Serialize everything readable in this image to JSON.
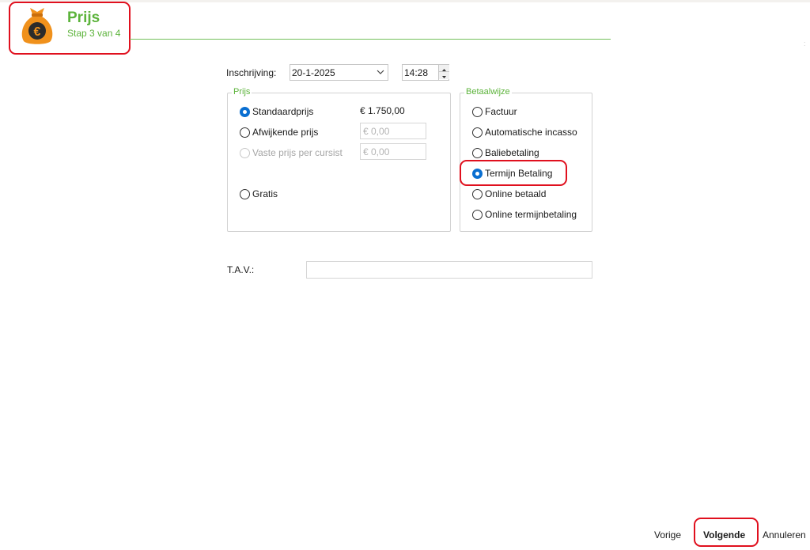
{
  "header": {
    "title": "Prijs",
    "step": "Stap 3 van 4",
    "icon": "money-bag-euro-icon"
  },
  "inschrijving": {
    "label": "Inschrijving:",
    "date": "20-1-2025",
    "time": "14:28"
  },
  "prijs": {
    "legend": "Prijs",
    "options": [
      {
        "label": "Standaardprijs",
        "selected": true,
        "value": "€ 1.750,00"
      },
      {
        "label": "Afwijkende prijs",
        "selected": false,
        "placeholder": "€ 0,00"
      },
      {
        "label": "Vaste prijs per cursist",
        "selected": false,
        "disabled": true,
        "placeholder": "€ 0,00"
      },
      {
        "label": "Gratis",
        "selected": false
      }
    ]
  },
  "betaalwijze": {
    "legend": "Betaalwijze",
    "options": [
      {
        "label": "Factuur",
        "selected": false
      },
      {
        "label": "Automatische incasso",
        "selected": false
      },
      {
        "label": "Baliebetaling",
        "selected": false
      },
      {
        "label": "Termijn Betaling",
        "selected": true
      },
      {
        "label": "Online betaald",
        "selected": false
      },
      {
        "label": "Online termijnbetaling",
        "selected": false
      }
    ]
  },
  "tav": {
    "label": "T.A.V.:",
    "value": ""
  },
  "footer": {
    "prev": "Vorige",
    "next": "Volgende",
    "cancel": "Annuleren"
  },
  "colors": {
    "accent": "#5cb33b",
    "highlight": "#e0101e",
    "radio_checked": "#0a6fd1",
    "icon_orange": "#f0911c"
  }
}
